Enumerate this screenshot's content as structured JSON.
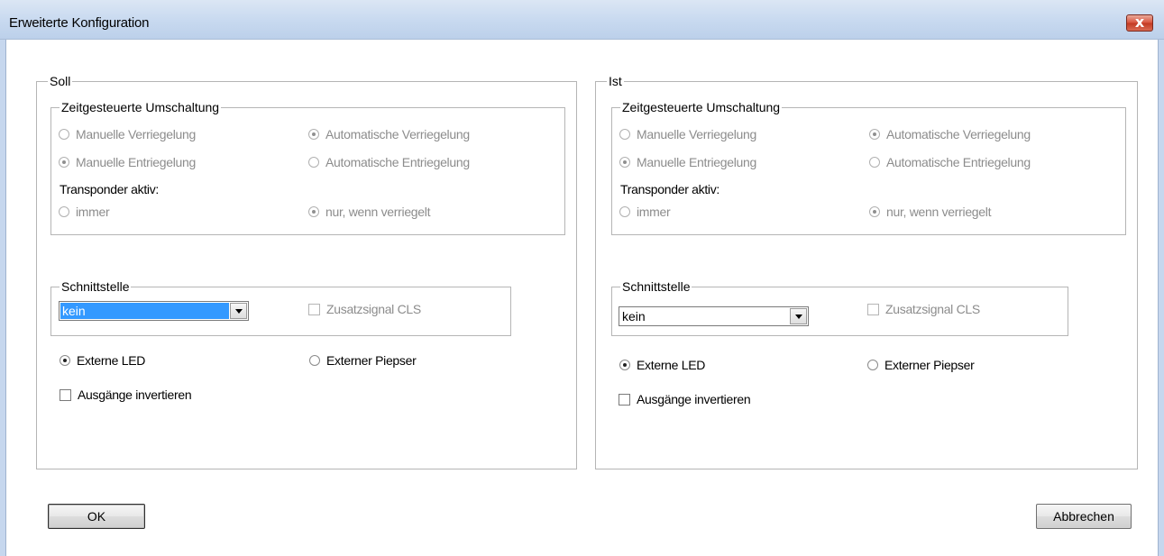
{
  "window": {
    "title": "Erweiterte Konfiguration",
    "close_glyph": "x"
  },
  "panels": {
    "soll": {
      "title": "Soll",
      "zeit": {
        "title": "Zeitgesteuerte Umschaltung",
        "manuelle_verriegelung": "Manuelle Verriegelung",
        "automatische_verriegelung": "Automatische Verriegelung",
        "manuelle_entriegelung": "Manuelle Entriegelung",
        "automatische_entriegelung": "Automatische Entriegelung",
        "transponder_label": "Transponder aktiv:",
        "immer": "immer",
        "nur_verriegelt": "nur, wenn verriegelt"
      },
      "schnittstelle": {
        "title": "Schnittstelle",
        "value": "kein",
        "zusatzsignal": "Zusatzsignal CLS"
      },
      "externe_led": "Externe LED",
      "externer_piepser": "Externer Piepser",
      "ausgaenge_invertieren": "Ausgänge invertieren"
    },
    "ist": {
      "title": "Ist",
      "zeit": {
        "title": "Zeitgesteuerte Umschaltung",
        "manuelle_verriegelung": "Manuelle Verriegelung",
        "automatische_verriegelung": "Automatische Verriegelung",
        "manuelle_entriegelung": "Manuelle Entriegelung",
        "automatische_entriegelung": "Automatische Entriegelung",
        "transponder_label": "Transponder aktiv:",
        "immer": "immer",
        "nur_verriegelt": "nur, wenn verriegelt"
      },
      "schnittstelle": {
        "title": "Schnittstelle",
        "value": "kein",
        "zusatzsignal": "Zusatzsignal CLS"
      },
      "externe_led": "Externe LED",
      "externer_piepser": "Externer Piepser",
      "ausgaenge_invertieren": "Ausgänge invertieren"
    }
  },
  "buttons": {
    "ok": "OK",
    "cancel": "Abbrechen"
  },
  "icons": {
    "close": "close-icon",
    "dropdown": "chevron-down-icon"
  },
  "colors": {
    "title_bar": "#c9daf0",
    "close_button": "#d8543e",
    "selection": "#3399ff",
    "disabled_text": "#8c8c8c"
  }
}
